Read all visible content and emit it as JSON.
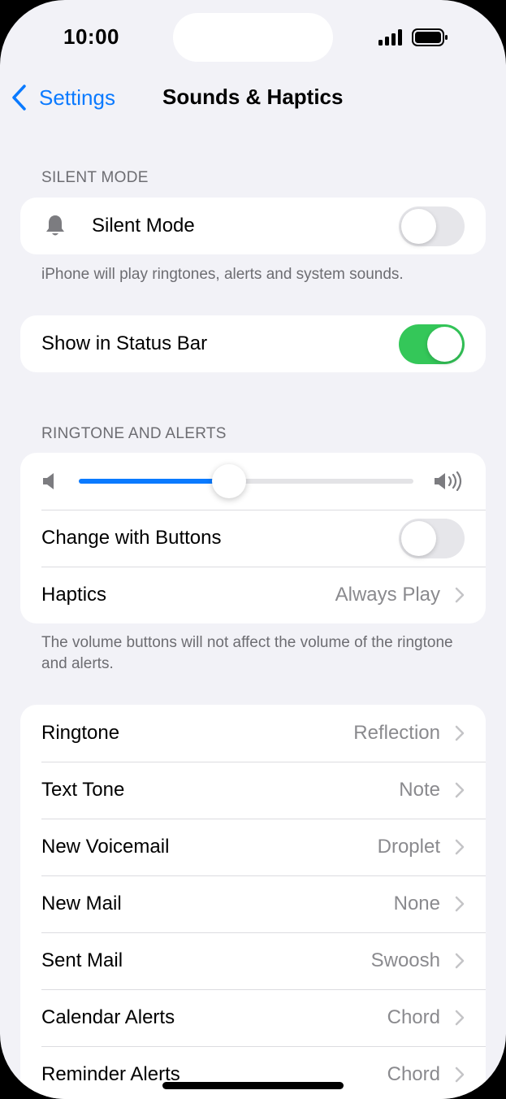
{
  "status_bar": {
    "time": "10:00"
  },
  "nav": {
    "back_label": "Settings",
    "title": "Sounds & Haptics"
  },
  "silent_section": {
    "header": "SILENT MODE",
    "silent_mode_label": "Silent Mode",
    "silent_mode_on": false,
    "footer": "iPhone will play ringtones, alerts and system sounds."
  },
  "status_bar_group": {
    "label": "Show in Status Bar",
    "on": true
  },
  "ringtone_section": {
    "header": "RINGTONE AND ALERTS",
    "volume_level": 0.45,
    "change_with_buttons_label": "Change with Buttons",
    "change_with_buttons_on": false,
    "haptics_label": "Haptics",
    "haptics_value": "Always Play",
    "footer": "The volume buttons will not affect the volume of the ringtone and alerts."
  },
  "sounds": [
    {
      "label": "Ringtone",
      "value": "Reflection"
    },
    {
      "label": "Text Tone",
      "value": "Note"
    },
    {
      "label": "New Voicemail",
      "value": "Droplet"
    },
    {
      "label": "New Mail",
      "value": "None"
    },
    {
      "label": "Sent Mail",
      "value": "Swoosh"
    },
    {
      "label": "Calendar Alerts",
      "value": "Chord"
    },
    {
      "label": "Reminder Alerts",
      "value": "Chord"
    }
  ],
  "colors": {
    "accent": "#0A7AFF",
    "toggle_on": "#34C759",
    "background": "#F2F2F7"
  }
}
